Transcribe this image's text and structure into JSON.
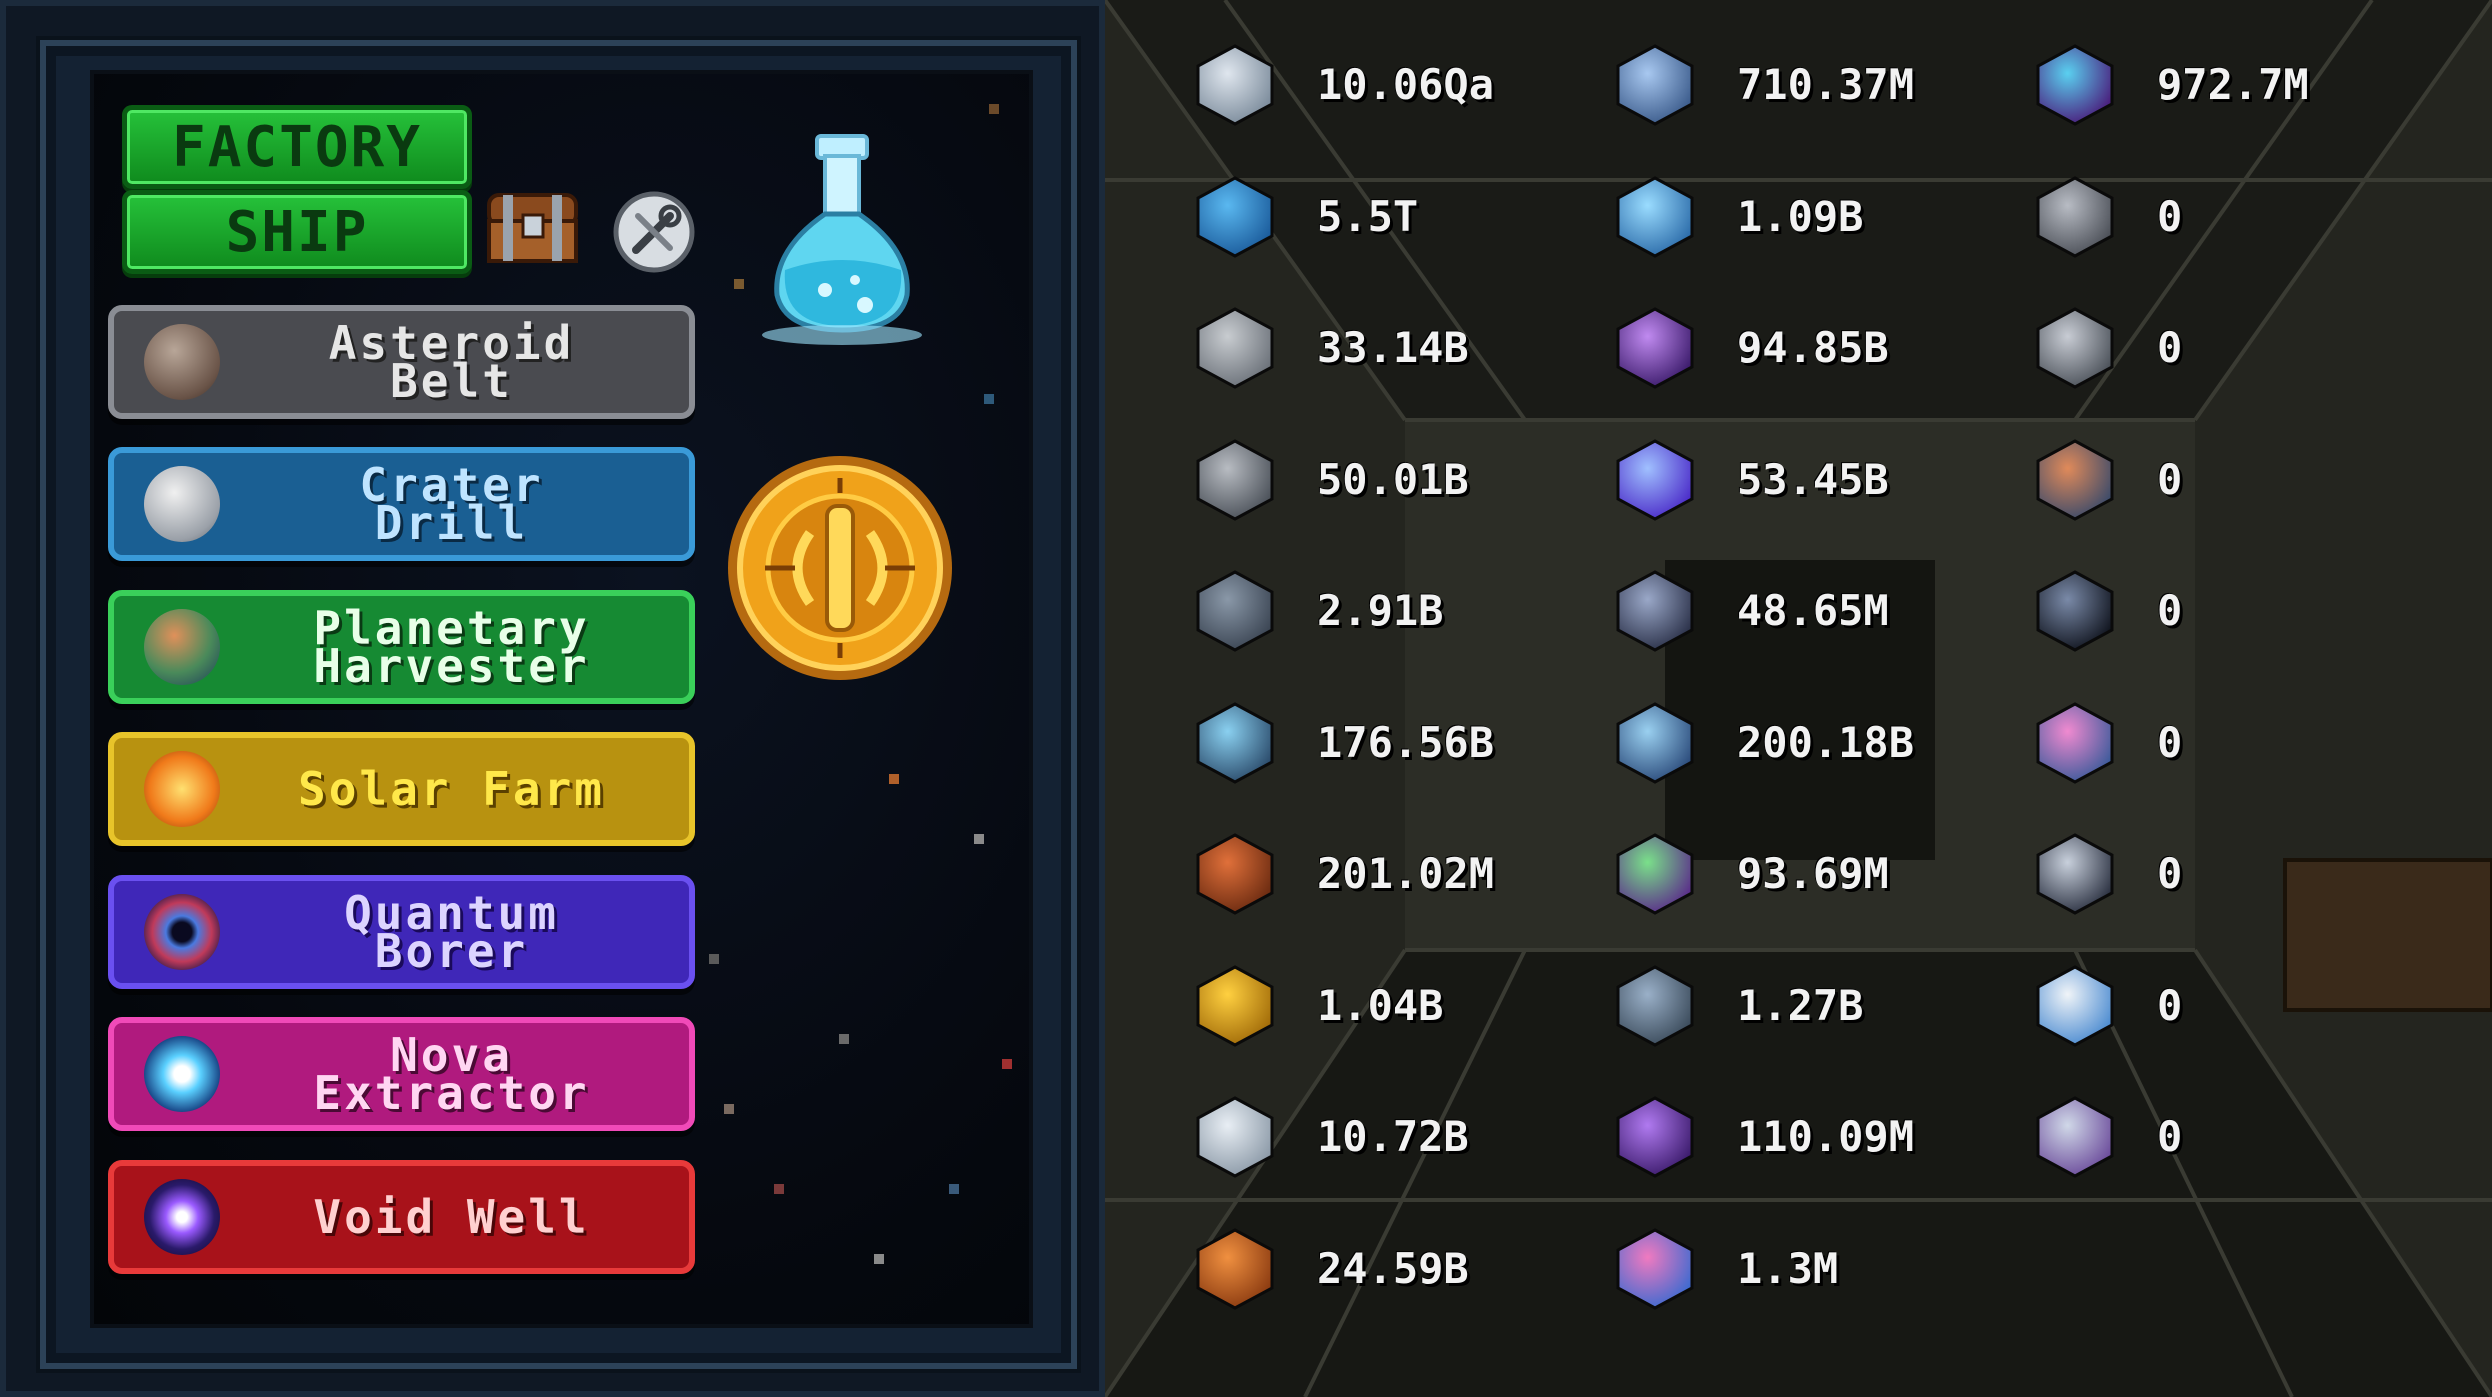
{
  "tabs": {
    "factory": "FACTORY",
    "ship": "SHIP"
  },
  "icons": {
    "chest": "treasure-chest-icon",
    "settings": "wrench-settings-icon",
    "research": "research-flask-icon",
    "coin": "gold-coin-icon"
  },
  "machines": [
    {
      "label": "Asteroid\nBelt",
      "icon": "asteroid-icon",
      "color": "#5a5a5e",
      "text": "#e8e8e8"
    },
    {
      "label": "Crater\nDrill",
      "icon": "moon-icon",
      "color": "#1f6fa8",
      "text": "#cfe9ff"
    },
    {
      "label": "Planetary\nHarvester",
      "icon": "planet-icon",
      "color": "#1e9a3a",
      "text": "#e6ffe6"
    },
    {
      "label": "Solar Farm",
      "icon": "sun-icon",
      "color": "#c9a40d",
      "text": "#fff0a0"
    },
    {
      "label": "Quantum\nBorer",
      "icon": "quantum-eye-icon",
      "color": "#4a2ec8",
      "text": "#e2dcff"
    },
    {
      "label": "Nova\nExtractor",
      "icon": "nova-icon",
      "color": "#c0208a",
      "text": "#ffd6f2"
    },
    {
      "label": "Void Well",
      "icon": "void-icon",
      "color": "#b8141a",
      "text": "#ffd0d0"
    }
  ],
  "resources": [
    [
      {
        "icon": "silver-ingot-icon",
        "value": "10.06Qa"
      },
      {
        "icon": "water-drop-icon",
        "value": "5.5T"
      },
      {
        "icon": "small-ingot-icon",
        "value": "33.14B"
      },
      {
        "icon": "steel-ingot-icon",
        "value": "50.01B"
      },
      {
        "icon": "crystal-chunk-icon",
        "value": "2.91B"
      },
      {
        "icon": "canister-icon",
        "value": "176.56B"
      },
      {
        "icon": "copper-ingot-icon",
        "value": "201.02M"
      },
      {
        "icon": "gold-ingot-icon",
        "value": "1.04B"
      },
      {
        "icon": "platinum-ingot-icon",
        "value": "10.72B"
      },
      {
        "icon": "gas-planet-icon",
        "value": "24.59B"
      }
    ],
    [
      {
        "icon": "blue-ingot-icon",
        "value": "710.37M"
      },
      {
        "icon": "ice-crystal-icon",
        "value": "1.09B"
      },
      {
        "icon": "galaxy-icon",
        "value": "94.85B"
      },
      {
        "icon": "star-burst-icon",
        "value": "53.45B"
      },
      {
        "icon": "vortex-icon",
        "value": "48.65M"
      },
      {
        "icon": "spiral-icon",
        "value": "200.18B"
      },
      {
        "icon": "atom-icon",
        "value": "93.69M"
      },
      {
        "icon": "cluster-icon",
        "value": "1.27B"
      },
      {
        "icon": "shard-icon",
        "value": "110.09M"
      },
      {
        "icon": "nebula-icon",
        "value": "1.3M"
      }
    ],
    [
      {
        "icon": "dark-crystal-icon",
        "value": "972.7M"
      },
      {
        "icon": "circuit-plate-icon",
        "value": "0"
      },
      {
        "icon": "rocket-part-icon",
        "value": "0"
      },
      {
        "icon": "core-device-icon",
        "value": "0"
      },
      {
        "icon": "black-hole-icon",
        "value": "0"
      },
      {
        "icon": "hourglass-cube-icon",
        "value": "0"
      },
      {
        "icon": "orbit-tool-icon",
        "value": "0"
      },
      {
        "icon": "gear-core-icon",
        "value": "0"
      },
      {
        "icon": "ringed-artifact-icon",
        "value": "0"
      }
    ]
  ]
}
